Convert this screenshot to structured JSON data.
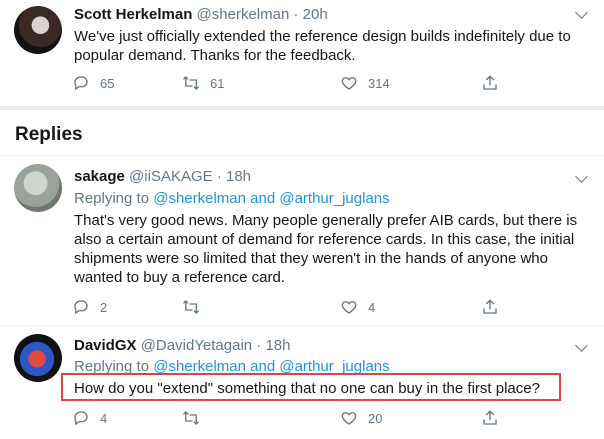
{
  "tweets": [
    {
      "name": "Scott Herkelman",
      "handle": "@sherkelman",
      "time": "· 20h",
      "text_lines": [
        "We've just officially extended the reference design builds indefinitely due to",
        "popular demand.  Thanks for the feedback."
      ],
      "reply_count": "65",
      "retweet_count": "61",
      "like_count": "314"
    },
    {
      "name": "sakage",
      "handle": "@iiSAKAGE",
      "time": "· 18h",
      "replying_prefix": "Replying to",
      "replying_links": "@sherkelman and @arthur_juglans",
      "text_lines": [
        "That's very good news.  Many people generally prefer AIB cards, but there is",
        "also a certain amount of demand for reference cards.  In this case, the initial",
        "shipments were so limited that they weren't in the hands of anyone who",
        "wanted to buy a reference card."
      ],
      "reply_count": "2",
      "retweet_count": "",
      "like_count": "4"
    },
    {
      "name": "DavidGX",
      "handle": "@DavidYetagain",
      "time": "· 18h",
      "replying_prefix": "Replying to",
      "replying_links": "@sherkelman and @arthur_juglans",
      "text_lines": [
        "How do you \"extend\" something that no one can buy in the first place?"
      ],
      "reply_count": "4",
      "retweet_count": "",
      "like_count": "20"
    }
  ],
  "replies_heading": "Replies",
  "icons": {
    "reply": "reply-icon",
    "retweet": "retweet-icon",
    "like": "heart-icon",
    "share": "share-icon",
    "more": "chevron-down-icon"
  },
  "colors": {
    "link": "#1b95e0",
    "muted": "#657786",
    "highlight": "#e0463f"
  }
}
